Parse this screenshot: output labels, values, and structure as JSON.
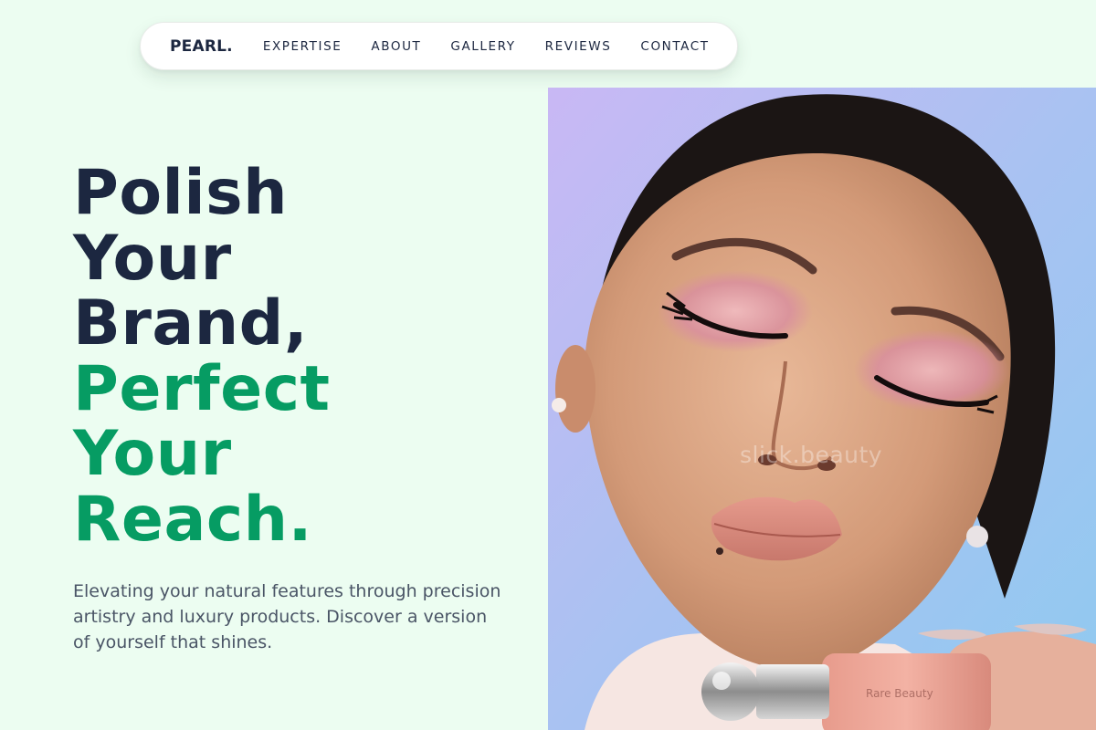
{
  "nav": {
    "logo": "PEARL.",
    "links": [
      "EXPERTISE",
      "ABOUT",
      "GALLERY",
      "REVIEWS",
      "CONTACT"
    ]
  },
  "hero": {
    "title_lines": [
      "Polish",
      "Your",
      "Brand,"
    ],
    "accent_lines": [
      "Perfect",
      "Your",
      "Reach."
    ],
    "description": "Elevating your natural features through precision artistry and luxury products. Discover a version of yourself that shines.",
    "image": {
      "watermark": "slick.beauty",
      "product_label": "Rare Beauty"
    }
  },
  "colors": {
    "background": "#ecfdf1",
    "text_dark": "#1c2740",
    "accent_green": "#069c63",
    "body_text": "#4a5566"
  }
}
